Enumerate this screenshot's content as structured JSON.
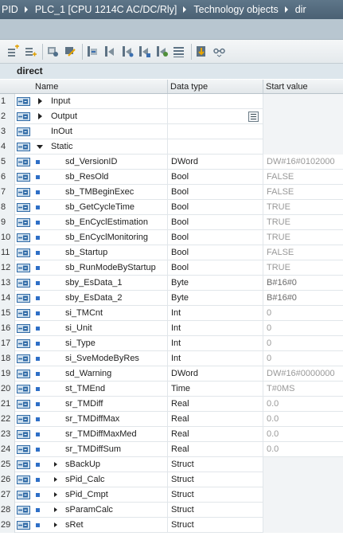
{
  "breadcrumb": {
    "items": [
      "PID",
      "PLC_1 [CPU 1214C AC/DC/Rly]",
      "Technology objects",
      "dir"
    ]
  },
  "toolbar": {
    "icons": [
      "insert-row-icon",
      "add-row-icon",
      "reset-icon",
      "monitor-icon",
      "snapshot-icon",
      "copy-snapshot-icon",
      "load-start-icon",
      "load-snapshot-icon",
      "apply-snapshot-icon",
      "set-values-icon",
      "expand-all-icon",
      "glasses-icon"
    ]
  },
  "block": {
    "name": "direct"
  },
  "table": {
    "headers": {
      "name": "Name",
      "data_type": "Data type",
      "start_value": "Start value"
    },
    "rows": [
      {
        "num": "1",
        "name": "Input",
        "type": "",
        "start": "",
        "level": 0,
        "expander": "collapsed"
      },
      {
        "num": "2",
        "name": "Output",
        "type": "",
        "start": "",
        "level": 0,
        "expander": "collapsed",
        "browse": true
      },
      {
        "num": "3",
        "name": "InOut",
        "type": "",
        "start": "",
        "level": 0,
        "expander": "none"
      },
      {
        "num": "4",
        "name": "Static",
        "type": "",
        "start": "",
        "level": 0,
        "expander": "expanded"
      },
      {
        "num": "5",
        "name": "sd_VersionID",
        "type": "DWord",
        "start": "DW#16#0102000",
        "level": 1
      },
      {
        "num": "6",
        "name": "sb_ResOld",
        "type": "Bool",
        "start": "FALSE",
        "level": 1
      },
      {
        "num": "7",
        "name": "sb_TMBeginExec",
        "type": "Bool",
        "start": "FALSE",
        "level": 1
      },
      {
        "num": "8",
        "name": "sb_GetCycleTime",
        "type": "Bool",
        "start": "TRUE",
        "level": 1
      },
      {
        "num": "9",
        "name": "sb_EnCyclEstimation",
        "type": "Bool",
        "start": "TRUE",
        "level": 1
      },
      {
        "num": "10",
        "name": "sb_EnCyclMonitoring",
        "type": "Bool",
        "start": "TRUE",
        "level": 1
      },
      {
        "num": "11",
        "name": "sb_Startup",
        "type": "Bool",
        "start": "FALSE",
        "level": 1
      },
      {
        "num": "12",
        "name": "sb_RunModeByStartup",
        "type": "Bool",
        "start": "TRUE",
        "level": 1
      },
      {
        "num": "13",
        "name": "sby_EsData_1",
        "type": "Byte",
        "start": "B#16#0",
        "level": 1,
        "dark": true
      },
      {
        "num": "14",
        "name": "sby_EsData_2",
        "type": "Byte",
        "start": "B#16#0",
        "level": 1,
        "dark": true
      },
      {
        "num": "15",
        "name": "si_TMCnt",
        "type": "Int",
        "start": "0",
        "level": 1
      },
      {
        "num": "16",
        "name": "si_Unit",
        "type": "Int",
        "start": "0",
        "level": 1
      },
      {
        "num": "17",
        "name": "si_Type",
        "type": "Int",
        "start": "0",
        "level": 1
      },
      {
        "num": "18",
        "name": "si_SveModeByRes",
        "type": "Int",
        "start": "0",
        "level": 1
      },
      {
        "num": "19",
        "name": "sd_Warning",
        "type": "DWord",
        "start": "DW#16#0000000",
        "level": 1
      },
      {
        "num": "20",
        "name": "st_TMEnd",
        "type": "Time",
        "start": "T#0MS",
        "level": 1
      },
      {
        "num": "21",
        "name": "sr_TMDiff",
        "type": "Real",
        "start": "0.0",
        "level": 1
      },
      {
        "num": "22",
        "name": "sr_TMDiffMax",
        "type": "Real",
        "start": "0.0",
        "level": 1
      },
      {
        "num": "23",
        "name": "sr_TMDiffMaxMed",
        "type": "Real",
        "start": "0.0",
        "level": 1
      },
      {
        "num": "24",
        "name": "sr_TMDiffSum",
        "type": "Real",
        "start": "0.0",
        "level": 1
      },
      {
        "num": "25",
        "name": "sBackUp",
        "type": "Struct",
        "start": "",
        "level": 1,
        "struct": true
      },
      {
        "num": "26",
        "name": "sPid_Calc",
        "type": "Struct",
        "start": "",
        "level": 1,
        "struct": true
      },
      {
        "num": "27",
        "name": "sPid_Cmpt",
        "type": "Struct",
        "start": "",
        "level": 1,
        "struct": true
      },
      {
        "num": "28",
        "name": "sParamCalc",
        "type": "Struct",
        "start": "",
        "level": 1,
        "struct": true
      },
      {
        "num": "29",
        "name": "sRet",
        "type": "Struct",
        "start": "",
        "level": 1,
        "struct": true
      }
    ]
  },
  "colors": {
    "breadcrumb_bg": "#4f6679",
    "row_bullet": "#2e6fc7",
    "start_value_text": "#999999"
  }
}
